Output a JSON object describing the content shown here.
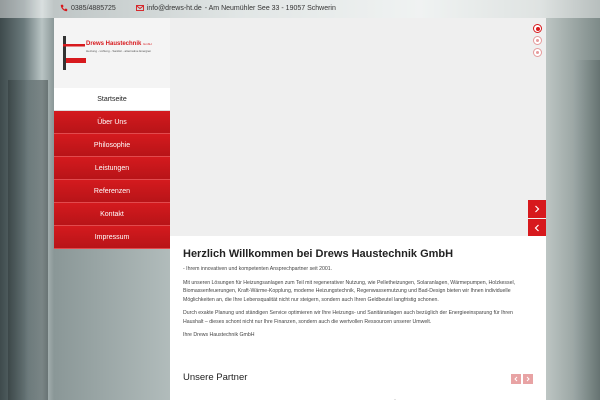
{
  "topbar": {
    "phone": "0385/4885725",
    "email": "info@drews-ht.de",
    "address": "- Am Neumühler See 33 - 19057 Schwerin"
  },
  "logo": {
    "name": "Drews Haustechnik",
    "suffix": "GmbH",
    "tagline": "Heizung - Lüftung - Sanitär - alternative Energien"
  },
  "nav": {
    "items": [
      {
        "label": "Startseite",
        "active": true
      },
      {
        "label": "Über Uns"
      },
      {
        "label": "Philosophie"
      },
      {
        "label": "Leistungen"
      },
      {
        "label": "Referenzen"
      },
      {
        "label": "Kontakt"
      },
      {
        "label": "Impressum"
      }
    ]
  },
  "slider": {
    "dots": 3,
    "active_index": 0
  },
  "content": {
    "title": "Herzlich Willkommen bei Drews Haustechnik GmbH",
    "intro": "- Ihrem innovativen und kompetenten Ansprechpartner seit 2001.",
    "p1": "Mit unseren Lösungen für Heizungsanlagen zum Teil mit regenerativer Nutzung, wie Pelletheizungen, Solaranlagen, Wärmepumpen, Holzkessel, Biomassenfeuerungen, Kraft-Wärme-Kopplung, moderne Heizungstechnik, Regenwassernutzung und Bad-Design bieten wir Ihnen individuelle Möglichkeiten an, die Ihre Lebensqualität nicht nur steigern, sondern auch Ihren Geldbeutel langfristig schonen.",
    "p2": "Durch exakte Planung und ständigen Service optimieren wir Ihre Heizungs- und Sanitäranlagen auch bezüglich der Energieeinsparung für Ihren Haushalt – dieses schont nicht nur Ihre Finanzen, sondern auch die wertvollen Ressourcen unserer Umwelt.",
    "signature": "Ihre Drews Haustechnik GmbH",
    "partners_heading": "Unsere Partner"
  },
  "colors": {
    "accent": "#d7191d"
  }
}
